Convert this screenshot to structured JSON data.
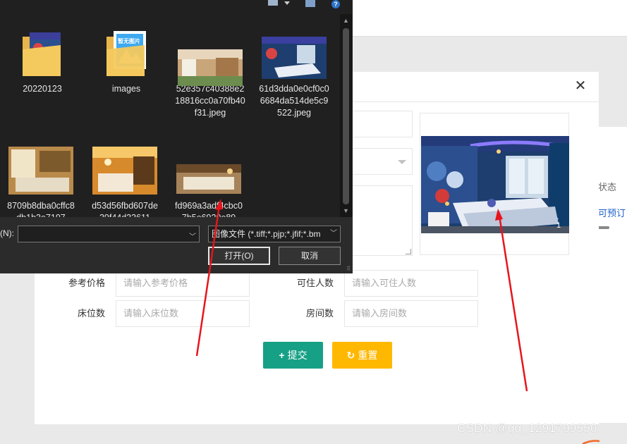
{
  "background": {
    "status_col": "状态",
    "book_link": "可预订"
  },
  "modal": {
    "close_icon": "close-icon",
    "fields": {
      "ref_price_label": "参考价格",
      "ref_price_placeholder": "请输入参考价格",
      "capacity_label": "可住人数",
      "capacity_placeholder": "请输入可住人数",
      "beds_label": "床位数",
      "beds_placeholder": "请输入床位数",
      "rooms_label": "房间数",
      "rooms_placeholder": "请输入房间数"
    },
    "buttons": {
      "submit_label": "提交",
      "submit_icon": "+",
      "reset_label": "重置",
      "reset_icon": "↻"
    },
    "colors": {
      "submit": "#16a086",
      "reset": "#ffb800"
    }
  },
  "file_dialog": {
    "files": [
      {
        "name": "20220123",
        "type": "folder"
      },
      {
        "name": "images",
        "type": "folder",
        "thumb_text": "暂无图片"
      },
      {
        "name": "52e357c40388e218816cc0a70fb40f31.jpeg",
        "type": "image"
      },
      {
        "name": "61d3dda0e0cf0c06684da514de5c9522.jpeg",
        "type": "image"
      },
      {
        "name": "8709b8dba0cffc8db1b3e7197",
        "type": "image"
      },
      {
        "name": "d53d56fbd607de39f44d33611",
        "type": "image"
      },
      {
        "name": "fd969a3adf4cbc07b5e6920e89",
        "type": "image"
      }
    ],
    "filename_label": "(N):",
    "filename_value": "",
    "filetype_value": "图像文件 (*.tiff;*.pjp;*.jfif;*.bm",
    "open_button": "打开(O)",
    "cancel_button": "取消"
  },
  "watermark": "CSDN @qq_1291799550"
}
